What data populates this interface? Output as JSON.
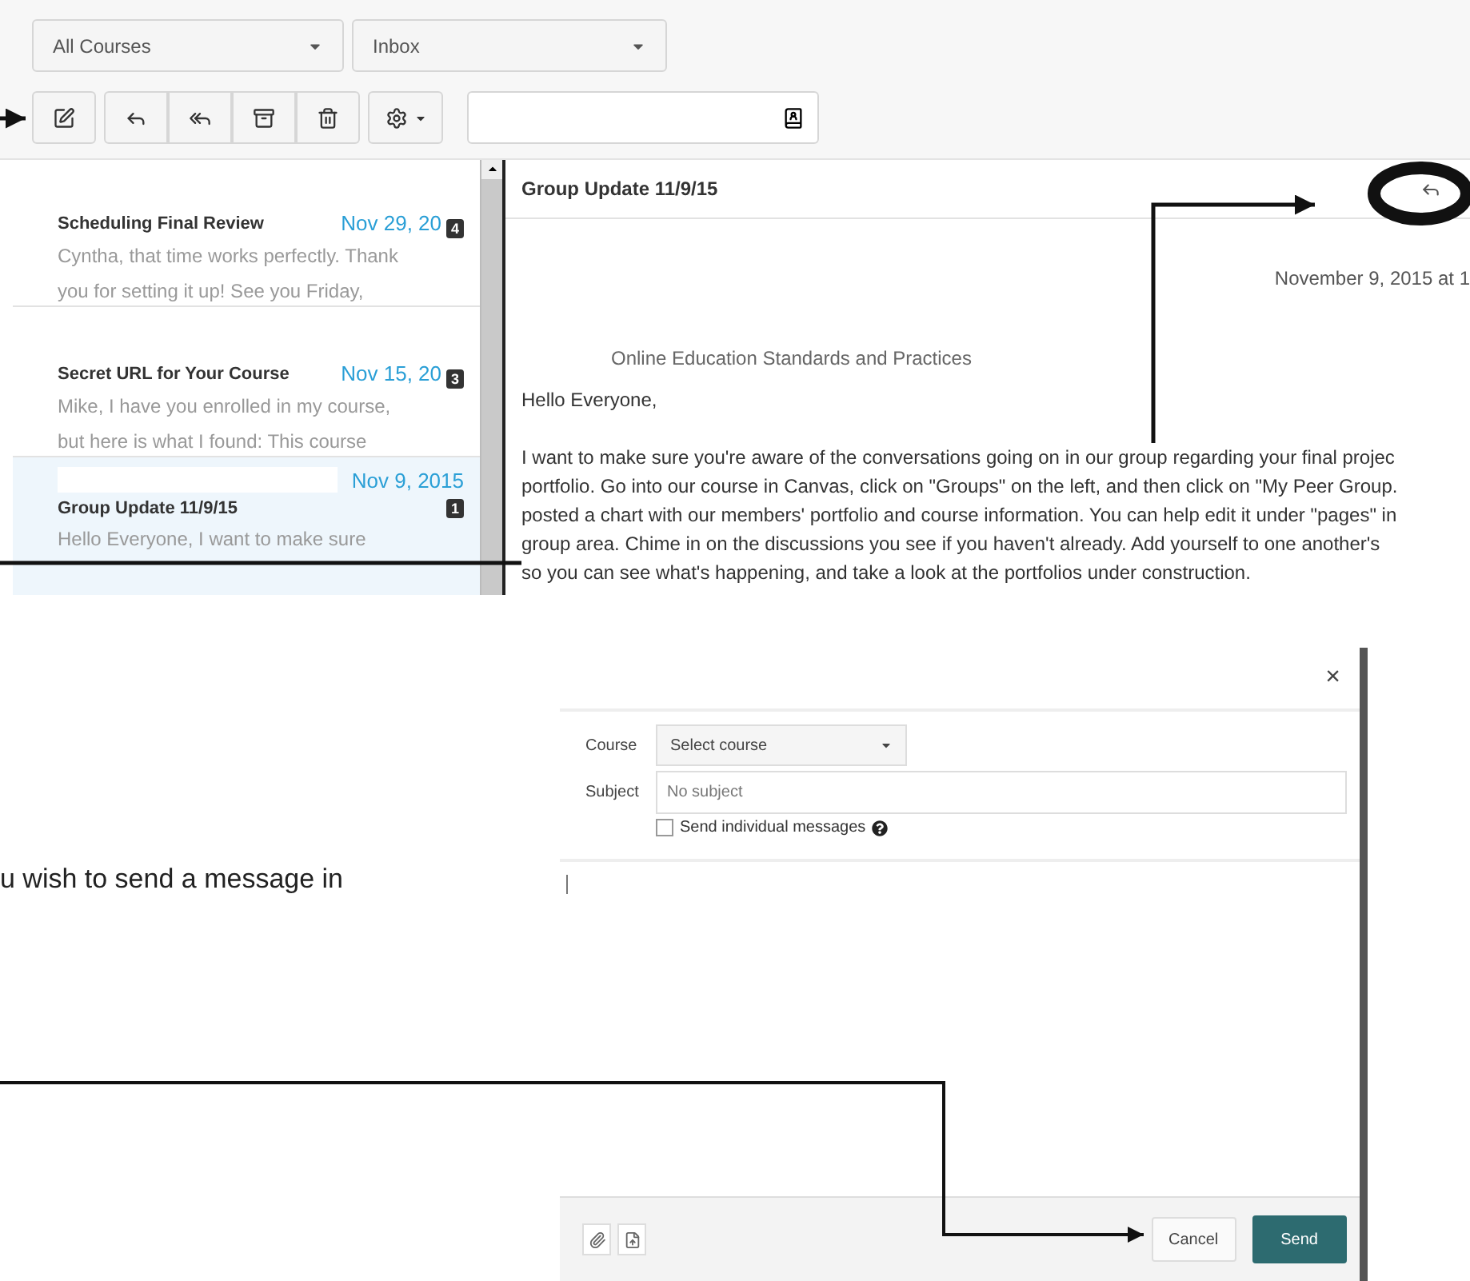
{
  "filters": [
    {
      "label": "All Courses"
    },
    {
      "label": "Inbox"
    }
  ],
  "conversations": [
    {
      "subject": "Scheduling Final Review",
      "date": "Nov 29, 20",
      "count": "4",
      "preview": [
        "Cyntha, that time works perfectly. Thank",
        "you for setting it up! See you Friday,"
      ],
      "selected": false,
      "redacted": false
    },
    {
      "subject": "Secret URL for Your Course",
      "date": "Nov 15, 20",
      "count": "3",
      "preview": [
        "Mike, I have you enrolled in my course,",
        "but here is what I found: This course"
      ],
      "selected": false,
      "redacted": false
    },
    {
      "subject": "Group Update 11/9/15",
      "date": "Nov 9, 2015",
      "count": "1",
      "preview": [
        "Hello Everyone, I want to make sure"
      ],
      "selected": true,
      "redacted": true
    }
  ],
  "message": {
    "subject": "Group Update 11/9/15",
    "date": "November 9, 2015 at 1",
    "heading": "Online Education Standards and Practices",
    "greeting": "Hello Everyone,",
    "lines": [
      "I want to make sure you're aware of the conversations going on in our group regarding your final projec",
      "portfolio. Go into our course in Canvas, click on \"Groups\" on the left, and then click on \"My Peer Group.",
      "posted a chart with our members' portfolio and course information. You can help edit it under \"pages\" in",
      "group area. Chime in on the discussions you see if you haven't already. Add yourself to one another's",
      "so you can see what's happening, and take a look at the portfolios under construction."
    ]
  },
  "instruction_text": "u wish to send a message in",
  "compose": {
    "close": "×",
    "course": {
      "label": "Course",
      "value": "Select course"
    },
    "subject": {
      "label": "Subject",
      "placeholder": "No subject"
    },
    "individual": {
      "label": "Send individual messages",
      "checked": false
    },
    "buttons": [
      {
        "label": "Cancel",
        "kind": "secondary"
      },
      {
        "label": "Send",
        "kind": "primary"
      }
    ]
  }
}
